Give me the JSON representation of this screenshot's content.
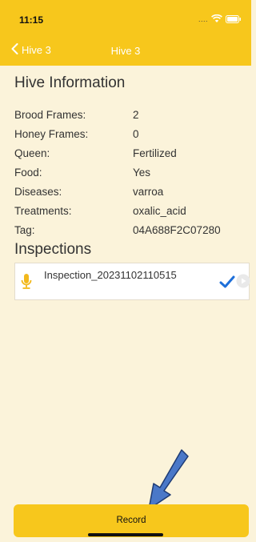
{
  "status_bar": {
    "time": "11:15",
    "signal": "....",
    "wifi_icon": "wifi-icon",
    "battery_icon": "battery-icon"
  },
  "nav": {
    "back_label": "Hive 3",
    "title": "Hive 3"
  },
  "hive_info": {
    "title": "Hive Information",
    "rows": [
      {
        "label": "Brood Frames:",
        "value": "2"
      },
      {
        "label": "Honey Frames:",
        "value": "0"
      },
      {
        "label": "Queen:",
        "value": "Fertilized"
      },
      {
        "label": "Food:",
        "value": "Yes"
      },
      {
        "label": "Diseases:",
        "value": "varroa"
      },
      {
        "label": "Treatments:",
        "value": "oxalic_acid"
      },
      {
        "label": "Tag:",
        "value": "04A688F2C07280"
      }
    ]
  },
  "inspections": {
    "title": "Inspections",
    "items": [
      {
        "name": "Inspection_20231102110515",
        "icon": "microphone-icon",
        "status_icon": "checkmark-icon",
        "action_icon": "play-icon"
      }
    ]
  },
  "record_button": {
    "label": "Record"
  },
  "colors": {
    "accent": "#f7c71c",
    "background": "#fbf3da",
    "check": "#1e6fd9",
    "annotation_arrow": "#4a78c8"
  }
}
